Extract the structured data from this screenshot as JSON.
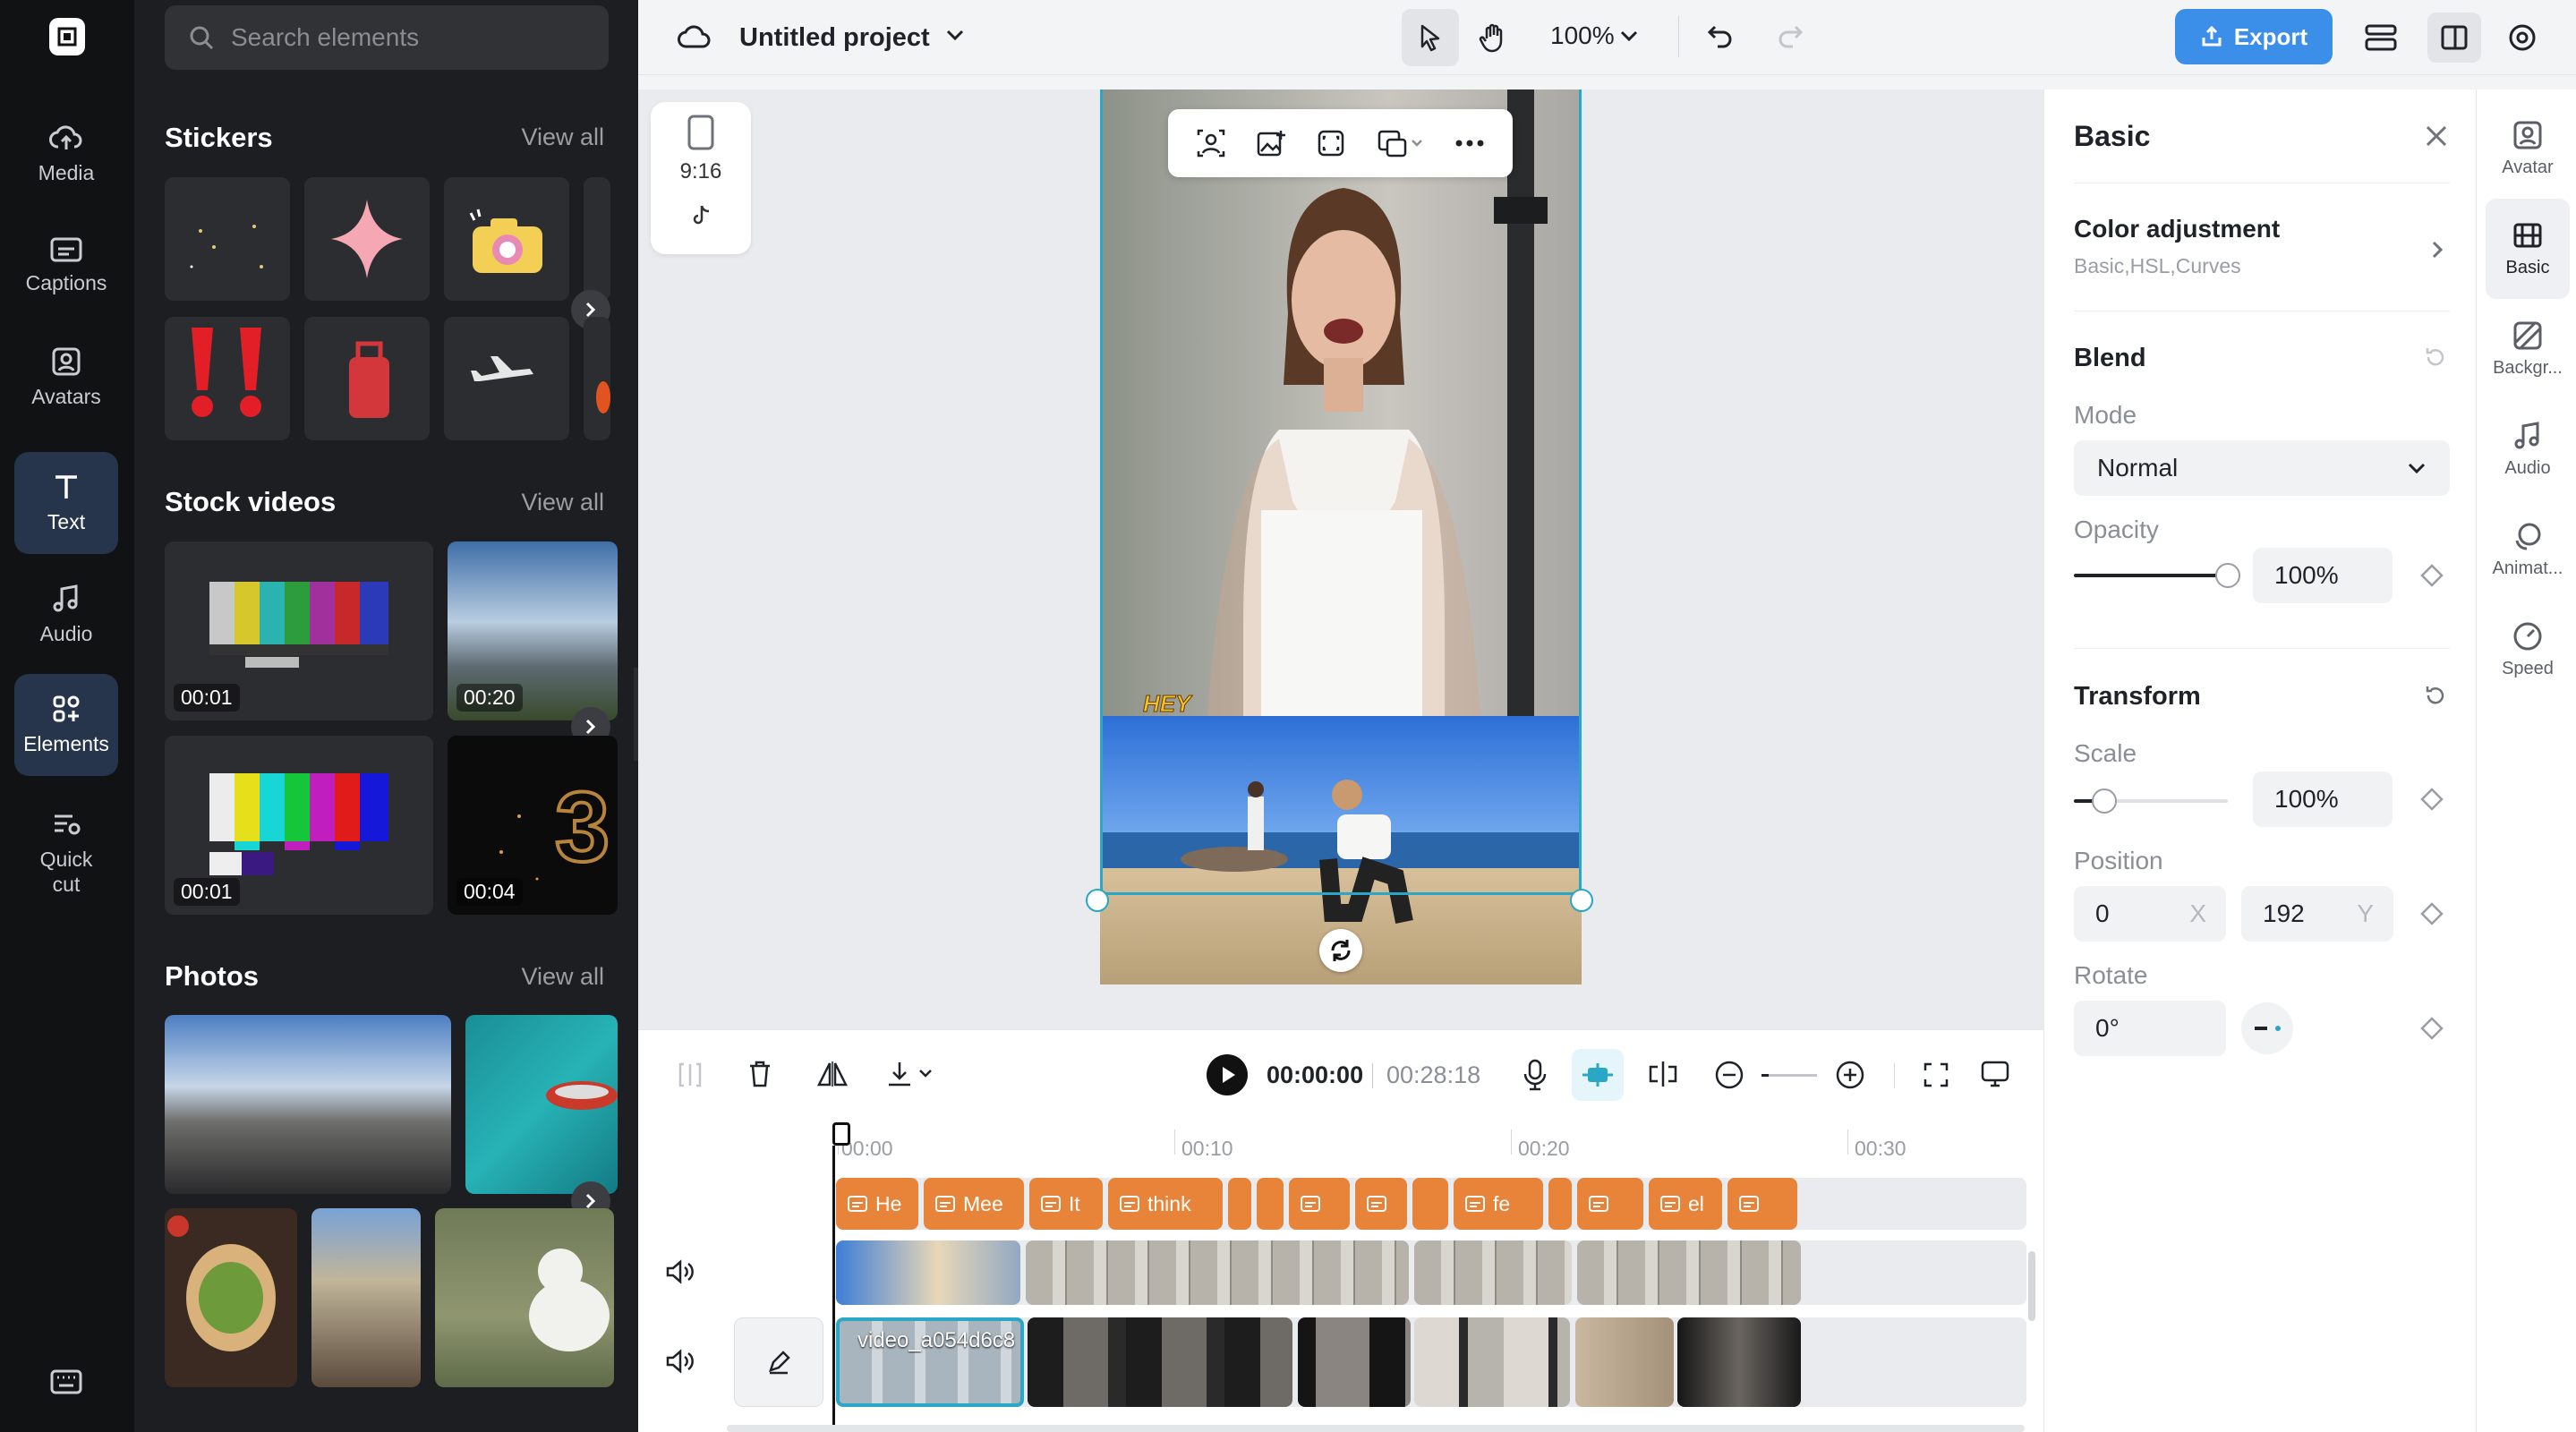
{
  "rail": {
    "items": [
      {
        "label": "Media",
        "icon": "cloud-upload-icon"
      },
      {
        "label": "Captions",
        "icon": "captions-icon"
      },
      {
        "label": "Avatars",
        "icon": "avatar-icon"
      },
      {
        "label": "Text",
        "icon": "text-icon"
      },
      {
        "label": "Audio",
        "icon": "music-icon"
      },
      {
        "label": "Elements",
        "icon": "elements-icon"
      },
      {
        "label": "Quick cut",
        "icon": "quick-cut-icon"
      }
    ]
  },
  "panel": {
    "search_placeholder": "Search elements",
    "stickers": {
      "title": "Stickers",
      "view_all": "View all"
    },
    "stock_videos": {
      "title": "Stock videos",
      "view_all": "View all",
      "durations": [
        "00:01",
        "00:20",
        "00:01",
        "00:04"
      ]
    },
    "photos": {
      "title": "Photos",
      "view_all": "View all"
    }
  },
  "topbar": {
    "project_name": "Untitled project",
    "zoom": "100%",
    "export_label": "Export"
  },
  "canvas": {
    "ratio": "9:16",
    "sticker_text": "HEY"
  },
  "player": {
    "current_time": "00:00:00",
    "total_time": "00:28:18"
  },
  "ruler": {
    "ticks": [
      "00:00",
      "00:10",
      "00:20",
      "00:30"
    ]
  },
  "captions": [
    "He",
    "Mee",
    "It",
    "think",
    "",
    "",
    "",
    "",
    "",
    "fe",
    "",
    "",
    "el",
    ""
  ],
  "main_clip_label": "video_a054d6c8",
  "right_panel": {
    "title": "Basic",
    "color_adjustment": {
      "title": "Color adjustment",
      "subtitle": "Basic,HSL,Curves"
    },
    "blend": {
      "title": "Blend",
      "mode_label": "Mode",
      "mode_value": "Normal",
      "opacity_label": "Opacity",
      "opacity_value": "100%",
      "opacity_fraction": 1.0
    },
    "transform": {
      "title": "Transform",
      "scale_label": "Scale",
      "scale_value": "100%",
      "position_label": "Position",
      "pos_x": "0",
      "pos_x_axis": "X",
      "pos_y": "192",
      "pos_y_axis": "Y",
      "rotate_label": "Rotate",
      "rotate_value": "0°"
    }
  },
  "right_tabs": [
    {
      "label": "Avatar",
      "icon": "avatar-icon"
    },
    {
      "label": "Basic",
      "icon": "basic-icon"
    },
    {
      "label": "Backgr...",
      "icon": "background-icon"
    },
    {
      "label": "Audio",
      "icon": "audio-icon"
    },
    {
      "label": "Animat...",
      "icon": "animation-icon"
    },
    {
      "label": "Speed",
      "icon": "speed-icon"
    }
  ],
  "colors": {
    "accent": "#3b8fe8",
    "caption": "#e8833a",
    "selection": "#2aa6c7",
    "rail": "#111214",
    "panel": "#1d1e21"
  }
}
